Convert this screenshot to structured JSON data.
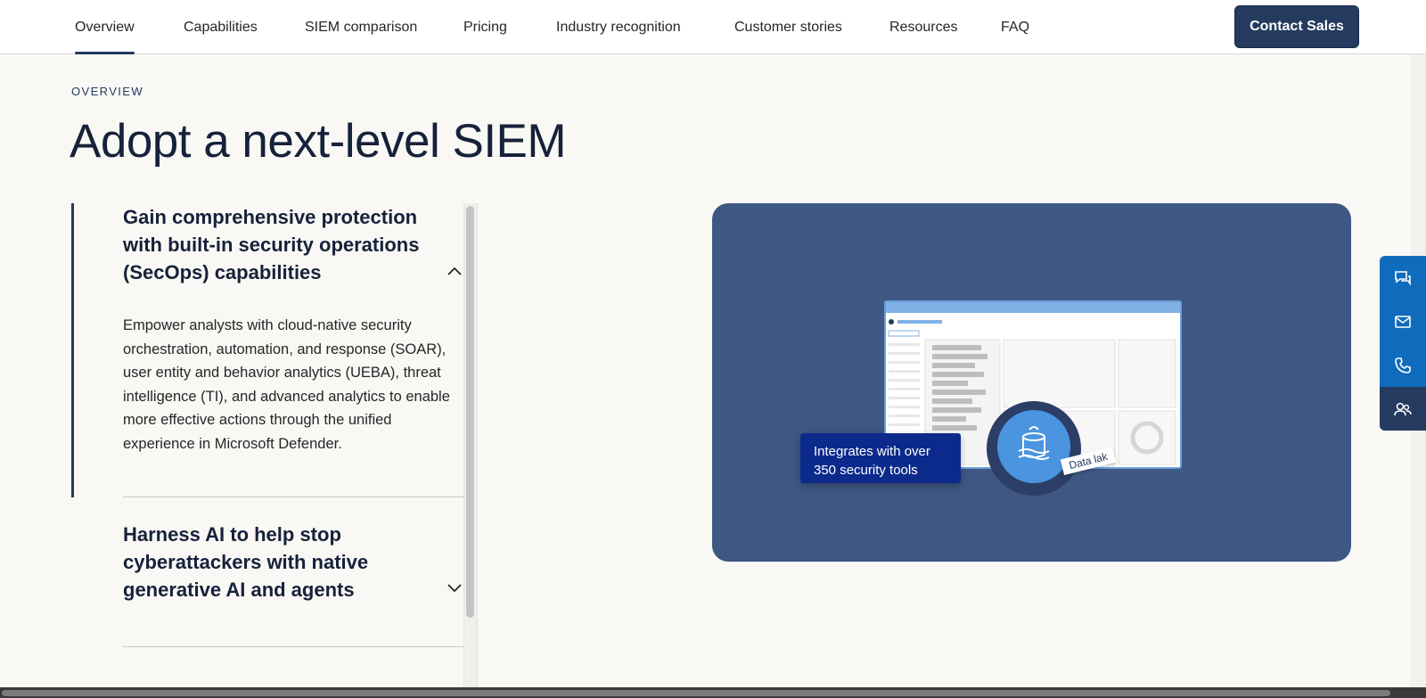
{
  "nav": {
    "tabs": [
      {
        "label": "Overview",
        "active": true
      },
      {
        "label": "Capabilities"
      },
      {
        "label": "SIEM comparison"
      },
      {
        "label": "Pricing"
      },
      {
        "label": "Industry recognition"
      },
      {
        "label": "Customer stories"
      },
      {
        "label": "Resources"
      },
      {
        "label": "FAQ"
      }
    ],
    "contact_label": "Contact Sales"
  },
  "section": {
    "eyebrow": "OVERVIEW",
    "title": "Adopt a next-level SIEM"
  },
  "accordion": {
    "items": [
      {
        "title": "Gain comprehensive protection with built-in security operations (SecOps) capabilities",
        "expanded": true,
        "body": "Empower analysts with cloud-native security orchestration, automation, and response (SOAR), user entity and behavior analytics (UEBA), threat intelligence (TI), and advanced analytics to enable more effective actions through the unified experience in Microsoft Defender."
      },
      {
        "title": "Harness AI to help stop cyberattackers with native generative AI and agents",
        "expanded": false
      }
    ]
  },
  "hero": {
    "badge_text": "Integrates with over 350 security tools",
    "lake_label": "Data lak"
  },
  "side_rail": {
    "icons": [
      "chat-icon",
      "mail-icon",
      "phone-icon",
      "people-icon"
    ]
  },
  "colors": {
    "accent": "#243a5e",
    "hero_bg": "#3e5783",
    "rail": "#0f6cbd",
    "badge": "#0c2a8c"
  }
}
